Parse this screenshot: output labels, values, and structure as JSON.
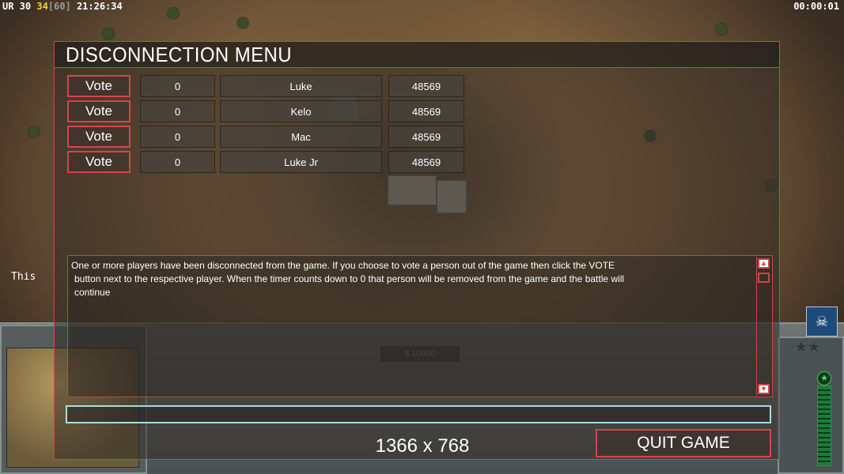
{
  "status_bar": {
    "prefix": "UR 30 ",
    "fps": "34",
    "fps_cap": "[60]",
    "clock": " 21:26:34",
    "game_timer": "00:00:01"
  },
  "side_text": "This",
  "dialog": {
    "title": "DISCONNECTION MENU",
    "vote_label": "Vote",
    "players": [
      {
        "votes": "0",
        "name": "Luke",
        "ping": "48569"
      },
      {
        "votes": "0",
        "name": "Kelo",
        "ping": "48569"
      },
      {
        "votes": "0",
        "name": "Mac",
        "ping": "48569"
      },
      {
        "votes": "0",
        "name": "Luke Jr",
        "ping": "48569"
      }
    ],
    "message_line1": "One or more players have been disconnected from the game. If you choose to vote a person out of the game then click the VOTE",
    "message_line2": "button next to the respective player. When the timer counts down to 0 that person will be removed from the game and the battle will",
    "message_line3": "continue",
    "chat_value": "",
    "resolution": "1366 x 768",
    "quit_label": "QUIT GAME"
  },
  "hud": {
    "money": "$ 10000"
  },
  "colors": {
    "accent_red": "#c9474a",
    "chat_border": "#a8dcdf",
    "fps_yellow": "#f3d43b"
  }
}
